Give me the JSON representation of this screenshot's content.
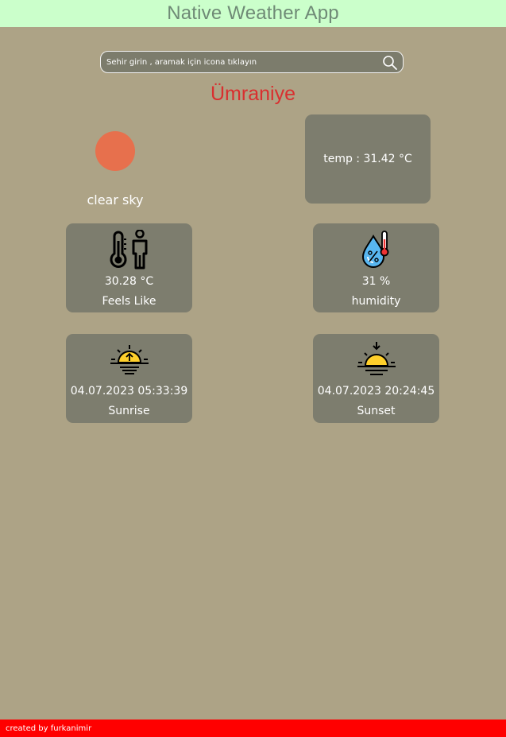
{
  "app": {
    "title": "Native Weather App"
  },
  "search": {
    "placeholder": "Sehir girin , aramak için icona tıklayın",
    "icon": "search-icon"
  },
  "weather": {
    "city": "Ümraniye",
    "description": "clear sky",
    "temp_text": "temp : 31.42 °C",
    "icon": "sun-icon",
    "sun_color": "#e7704d"
  },
  "cards": {
    "feels_like": {
      "value": "30.28 °C",
      "label": "Feels Like",
      "icon": "feels-like-icon"
    },
    "humidity": {
      "value": "31 %",
      "label": "humidity",
      "icon": "humidity-icon"
    },
    "sunrise": {
      "value": "04.07.2023 05:33:39",
      "label": "Sunrise",
      "icon": "sunrise-icon"
    },
    "sunset": {
      "value": "04.07.2023 20:24:45",
      "label": "Sunset",
      "icon": "sunset-icon"
    }
  },
  "footer": {
    "text": "created by furkanimir"
  },
  "colors": {
    "background": "#ada386",
    "header": "#cbffcb",
    "card": "#7d7d6e",
    "city": "#d92f2f",
    "footer": "#ff0000"
  }
}
